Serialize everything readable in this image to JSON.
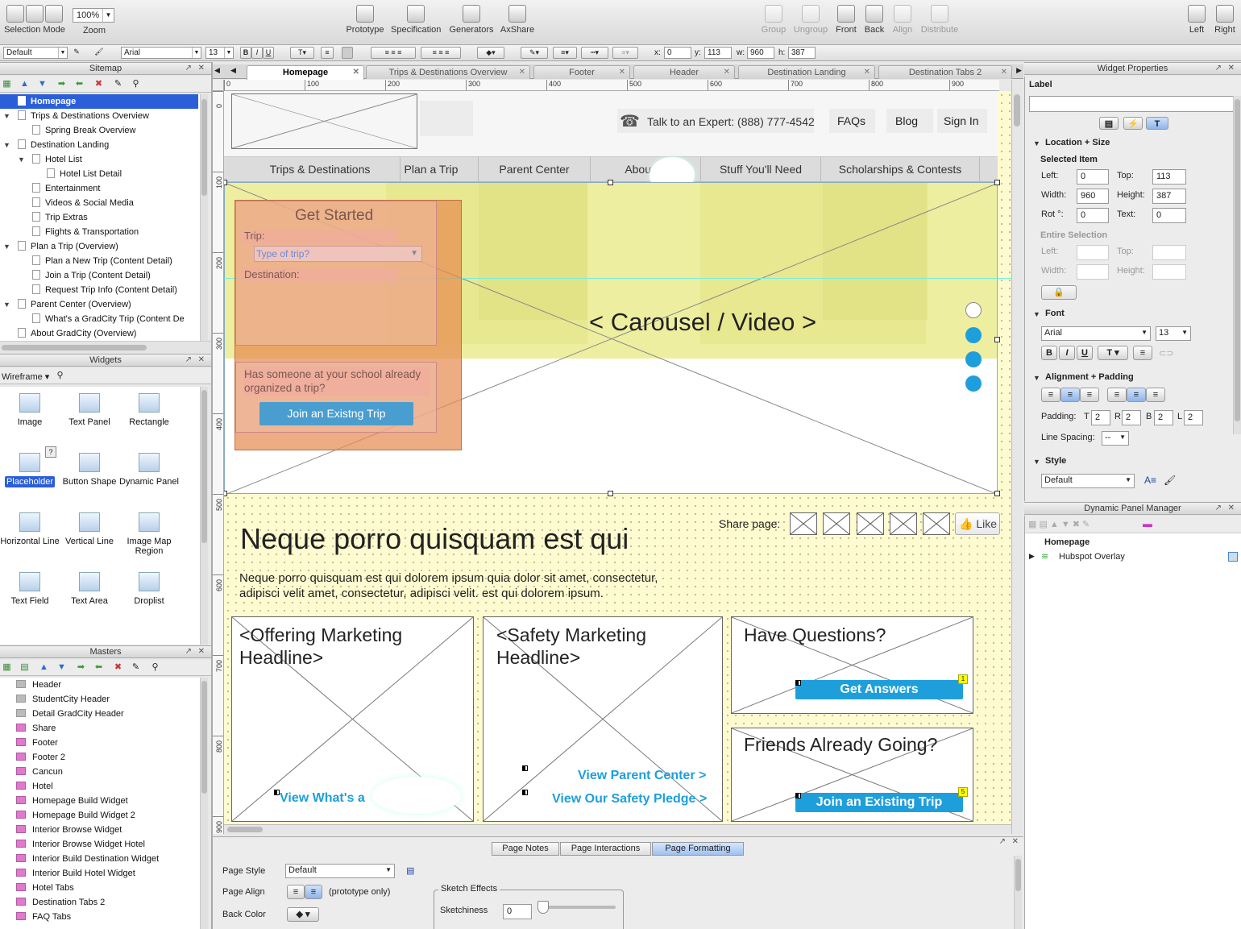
{
  "toolbar": {
    "selection_mode": "Selection Mode",
    "zoom_label": "Zoom",
    "zoom_value": "100%",
    "prototype": "Prototype",
    "specification": "Specification",
    "generators": "Generators",
    "axshare": "AxShare",
    "group": "Group",
    "ungroup": "Ungroup",
    "front": "Front",
    "back": "Back",
    "align": "Align",
    "distribute": "Distribute",
    "left": "Left",
    "right": "Right"
  },
  "format_bar": {
    "style": "Default",
    "font": "Arial",
    "size": "13",
    "bold": "B",
    "italic": "I",
    "underline": "U",
    "x_label": "x:",
    "x": "0",
    "y_label": "y:",
    "y": "113",
    "w_label": "w:",
    "w": "960",
    "h_label": "h:",
    "h": "387"
  },
  "sitemap": {
    "title": "Sitemap",
    "items": [
      {
        "label": "Homepage",
        "selected": true
      },
      {
        "label": "Trips & Destinations Overview"
      },
      {
        "label": "Spring Break Overview"
      },
      {
        "label": "Destination Landing"
      },
      {
        "label": "Hotel List"
      },
      {
        "label": "Hotel List Detail"
      },
      {
        "label": "Entertainment"
      },
      {
        "label": "Videos & Social Media"
      },
      {
        "label": "Trip Extras"
      },
      {
        "label": "Flights & Transportation"
      },
      {
        "label": "Plan a Trip (Overview)"
      },
      {
        "label": "Plan a New Trip (Content Detail)"
      },
      {
        "label": "Join a Trip (Content Detail)"
      },
      {
        "label": "Request Trip Info (Content Detail)"
      },
      {
        "label": "Parent Center (Overview)"
      },
      {
        "label": "What's a GradCity Trip (Content De"
      },
      {
        "label": "About GradCity (Overview)"
      }
    ]
  },
  "widgets": {
    "title": "Widgets",
    "library": "Wireframe",
    "items": [
      {
        "label": "Image"
      },
      {
        "label": "Text Panel"
      },
      {
        "label": "Rectangle"
      },
      {
        "label": "Placeholder"
      },
      {
        "label": "Button Shape"
      },
      {
        "label": "Dynamic Panel"
      },
      {
        "label": "Horizontal Line"
      },
      {
        "label": "Vertical Line"
      },
      {
        "label": "Image Map Region"
      },
      {
        "label": "Text Field"
      },
      {
        "label": "Text Area"
      },
      {
        "label": "Droplist"
      }
    ],
    "help": "?"
  },
  "masters": {
    "title": "Masters",
    "items": [
      {
        "label": "Header",
        "type": "gray"
      },
      {
        "label": "StudentCity Header",
        "type": "gray"
      },
      {
        "label": "Detail GradCity Header",
        "type": "gray"
      },
      {
        "label": "Share",
        "type": "pink"
      },
      {
        "label": "Footer",
        "type": "pink"
      },
      {
        "label": "Footer 2",
        "type": "pink"
      },
      {
        "label": "Cancun",
        "type": "pink"
      },
      {
        "label": "Hotel",
        "type": "pink"
      },
      {
        "label": "Homepage Build Widget",
        "type": "pink"
      },
      {
        "label": "Homepage Build Widget 2",
        "type": "pink"
      },
      {
        "label": "Interior Browse Widget",
        "type": "pink"
      },
      {
        "label": "Interior Browse Widget Hotel",
        "type": "pink"
      },
      {
        "label": "Interior Build Destination Widget",
        "type": "pink"
      },
      {
        "label": "Interior Build Hotel Widget",
        "type": "pink"
      },
      {
        "label": "Hotel Tabs",
        "type": "pink"
      },
      {
        "label": "Destination Tabs 2",
        "type": "pink"
      },
      {
        "label": "FAQ Tabs",
        "type": "pink"
      }
    ]
  },
  "tabs": [
    {
      "label": "Homepage",
      "active": true
    },
    {
      "label": "Trips & Destinations Overview"
    },
    {
      "label": "Footer"
    },
    {
      "label": "Header"
    },
    {
      "label": "Destination Landing"
    },
    {
      "label": "Destination Tabs 2"
    }
  ],
  "ruler": {
    "h": [
      "0",
      "100",
      "200",
      "300",
      "400",
      "500",
      "600",
      "700",
      "800",
      "900"
    ],
    "v": [
      "0",
      "100",
      "200",
      "300",
      "400",
      "500",
      "600",
      "700",
      "800",
      "900"
    ]
  },
  "wire": {
    "phone_text": "Talk to an Expert: (888) 777-4542",
    "faqs": "FAQs",
    "blog": "Blog",
    "sign_in": "Sign In",
    "nav": [
      "Trips & Destinations",
      "Plan a Trip",
      "Parent Center",
      "About G",
      "Stuff You'll Need",
      "Scholarships & Contests"
    ],
    "get_started": "Get Started",
    "trip_label": "Trip:",
    "trip_placeholder": "Type of trip?",
    "destination_label": "Destination:",
    "organized_text": "Has someone at your school already organized a trip?",
    "join_existing_btn": "Join an Existng Trip",
    "carousel": "< Carousel / Video >",
    "share_label": "Share page:",
    "like": "Like",
    "headline": "Neque porro quisquam est qui",
    "body": "Neque porro quisquam est qui dolorem ipsum quia dolor sit amet, consectetur, adipisci velit  amet, consectetur, adipisci velit.  est qui dolorem ipsum.",
    "offering": "<Offering Marketing Headline>",
    "safety": "<Safety Marketing Headline>",
    "whats_a": "View What's a",
    "view_parent": "View Parent Center >",
    "view_safety": "View Our Safety Pledge >",
    "have_questions": "Have Questions?",
    "get_answers": "Get Answers",
    "badge1": "1",
    "friends": "Friends Already Going?",
    "join_existing2": "Join an Existing Trip",
    "badge5": "5"
  },
  "properties": {
    "title": "Widget Properties",
    "label": "Label",
    "label_value": "",
    "loc_size": "Location + Size",
    "selected_item": "Selected Item",
    "left_l": "Left:",
    "left": "0",
    "top_l": "Top:",
    "top": "113",
    "width_l": "Width:",
    "width": "960",
    "height_l": "Height:",
    "height": "387",
    "rot_l": "Rot °:",
    "rot": "0",
    "text_l": "Text:",
    "text": "0",
    "entire": "Entire Selection",
    "font_sec": "Font",
    "font": "Arial",
    "font_size": "13",
    "align_sec": "Alignment + Padding",
    "padding_l": "Padding:",
    "pad_t_l": "T",
    "pad_t": "2",
    "pad_r_l": "R",
    "pad_r": "2",
    "pad_b_l": "B",
    "pad_b": "2",
    "pad_l_l": "L",
    "pad_l": "2",
    "line_spacing_l": "Line Spacing:",
    "line_spacing": "--",
    "style_sec": "Style",
    "style": "Default"
  },
  "dpm": {
    "title": "Dynamic Panel Manager",
    "root": "Homepage",
    "panel": "Hubspot Overlay"
  },
  "page_notes": {
    "tabs": [
      "Page Notes",
      "Page Interactions",
      "Page Formatting"
    ],
    "page_style_l": "Page Style",
    "page_style": "Default",
    "page_align_l": "Page Align",
    "proto_only": "(prototype only)",
    "back_color_l": "Back Color",
    "sketch_effects": "Sketch Effects",
    "sketchiness_l": "Sketchiness",
    "sketchiness": "0"
  },
  "colors": {
    "accent_blue": "#1e9fdb",
    "selection_blue": "#2b5fd9",
    "carousel_yellow": "#eeeea0",
    "overlay_orange": "#e8a070",
    "grid_yellow": "#fffbd0"
  }
}
